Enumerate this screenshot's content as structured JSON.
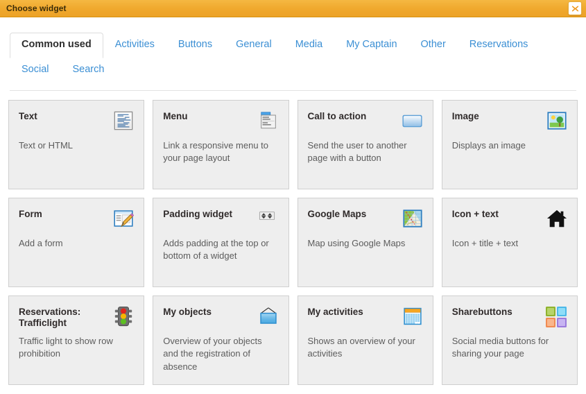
{
  "window": {
    "title": "Choose widget",
    "close_label": "✖",
    "accent_color": "#f0a92e",
    "link_color": "#3b8fd4"
  },
  "tabs": [
    {
      "label": "Common used",
      "active": true
    },
    {
      "label": "Activities",
      "active": false
    },
    {
      "label": "Buttons",
      "active": false
    },
    {
      "label": "General",
      "active": false
    },
    {
      "label": "Media",
      "active": false
    },
    {
      "label": "My Captain",
      "active": false
    },
    {
      "label": "Other",
      "active": false
    },
    {
      "label": "Reservations",
      "active": false
    },
    {
      "label": "Social",
      "active": false
    },
    {
      "label": "Search",
      "active": false
    }
  ],
  "widgets": [
    {
      "title": "Text",
      "desc": "Text or HTML",
      "icon": "document-text-icon"
    },
    {
      "title": "Menu",
      "desc": "Link a responsive menu to your page layout",
      "icon": "dropdown-menu-icon"
    },
    {
      "title": "Call to action",
      "desc": "Send the user to another page with a button",
      "icon": "blue-button-icon"
    },
    {
      "title": "Image",
      "desc": "Displays an image",
      "icon": "picture-icon"
    },
    {
      "title": "Form",
      "desc": "Add a form",
      "icon": "form-pencil-icon"
    },
    {
      "title": "Padding widget",
      "desc": "Adds padding at the top or bottom of a widget",
      "icon": "spinner-arrows-icon"
    },
    {
      "title": "Google Maps",
      "desc": "Map using Google Maps",
      "icon": "map-icon"
    },
    {
      "title": "Icon + text",
      "desc": "Icon + title + text",
      "icon": "home-icon"
    },
    {
      "title": "Reservations: Trafficlight",
      "desc": "Traffic light to show row prohibition",
      "icon": "traffic-light-icon"
    },
    {
      "title": "My objects",
      "desc": "Overview of your objects and the registration of absence",
      "icon": "hanging-sign-icon"
    },
    {
      "title": "My activities",
      "desc": "Shows an overview of your activities",
      "icon": "calendar-icon"
    },
    {
      "title": "Sharebuttons",
      "desc": "Social media buttons for sharing your page",
      "icon": "share-squares-icon"
    }
  ]
}
